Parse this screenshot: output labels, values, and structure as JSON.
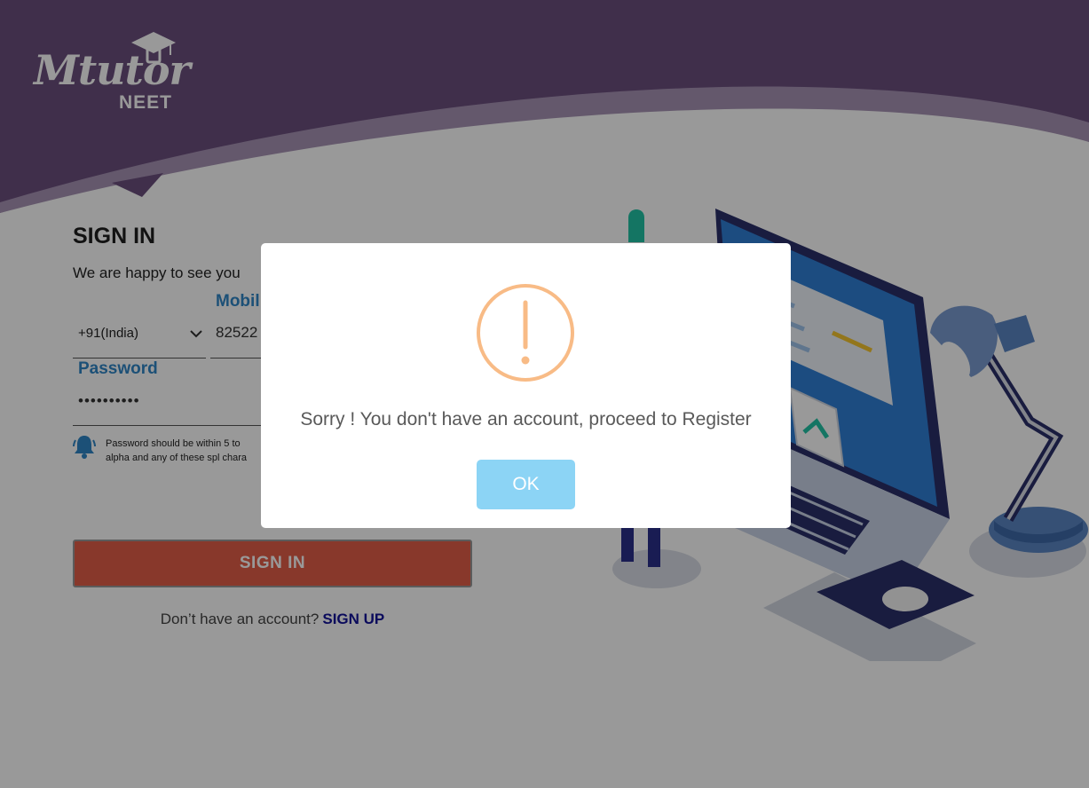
{
  "brand": {
    "logo_text": "Mtutor",
    "logo_subtext": "NEET"
  },
  "signin": {
    "title": "SIGN IN",
    "subtitle": "We are happy to see you",
    "country_code": "+91(India)",
    "mobile_label": "Mobil",
    "mobile_value": "82522",
    "password_label": "Password",
    "password_value": "••••••••••",
    "password_hint_line1": "Password should be within 5 to",
    "password_hint_line2": "alpha and any of these spl chara",
    "button_label": "SIGN IN",
    "no_account_text": "Don’t have an account?",
    "signup_link": "SIGN UP"
  },
  "modal": {
    "icon": "warning-icon",
    "message": "Sorry ! You don't have an account, proceed to Register",
    "ok_label": "OK"
  },
  "colors": {
    "header_purple": "#6b4f7e",
    "accent_blue": "#2f86c6",
    "signin_red": "#e35e48",
    "signup_link": "#13139a",
    "warning_orange": "#f8bb86",
    "ok_button": "#8cd4f5"
  }
}
